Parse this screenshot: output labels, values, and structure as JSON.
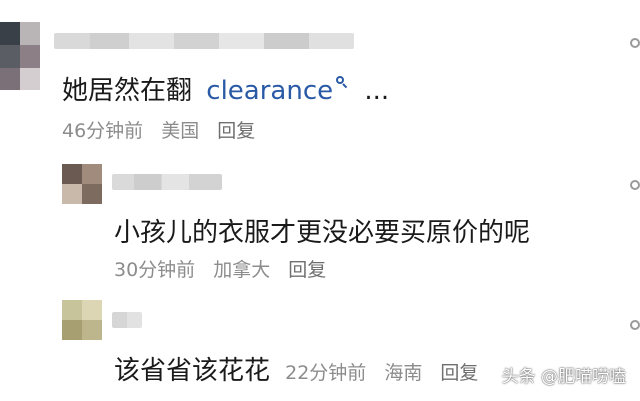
{
  "comments": [
    {
      "text": "她居然在翻",
      "link_text": "clearance",
      "link_icon": "search-icon",
      "ellipsis": "...",
      "time": "46分钟前",
      "location": "美国",
      "reply_label": "回复",
      "avatar": "pixelated-avatar",
      "username": "mosaic-blurred"
    },
    {
      "text": "小孩儿的衣服才更没必要买原价的呢",
      "time": "30分钟前",
      "location": "加拿大",
      "reply_label": "回复",
      "avatar": "pixelated-avatar",
      "username": "mosaic-blurred"
    },
    {
      "text": "该省省该花花",
      "time": "22分钟前",
      "location": "海南",
      "reply_label": "回复",
      "avatar": "pixelated-avatar",
      "username": "mosaic-blurred"
    }
  ],
  "watermark": "头条 @肥喵唠嗑",
  "colors": {
    "link": "#2a5aa6",
    "meta": "#8c8c8c",
    "text": "#1a1a1a"
  }
}
